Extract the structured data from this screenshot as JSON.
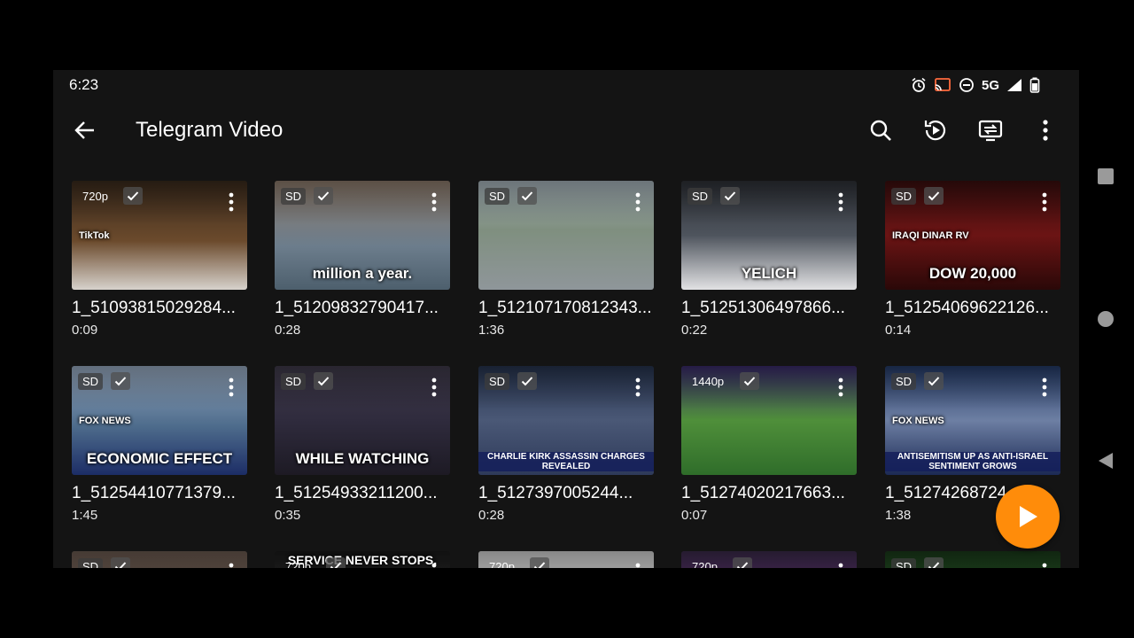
{
  "status": {
    "time": "6:23",
    "network": "5G"
  },
  "header": {
    "title": "Telegram Video"
  },
  "colors": {
    "accent": "#ff8c0a",
    "background": "#141414"
  },
  "videos": [
    {
      "quality": "720p",
      "name": "1_51093815029284...",
      "duration": "0:09",
      "caption": "",
      "overlay": "TikTok"
    },
    {
      "quality": "SD",
      "name": "1_51209832790417...",
      "duration": "0:28",
      "caption": "million a year.",
      "overlay": ""
    },
    {
      "quality": "SD",
      "name": "1_512107170812343...",
      "duration": "1:36",
      "caption": "",
      "overlay": ""
    },
    {
      "quality": "SD",
      "name": "1_51251306497866...",
      "duration": "0:22",
      "caption": "YELICH",
      "overlay": ""
    },
    {
      "quality": "SD",
      "name": "1_51254069622126...",
      "duration": "0:14",
      "caption": "DOW 20,000",
      "overlay": "IRAQI DINAR RV"
    },
    {
      "quality": "SD",
      "name": "1_51254410771379...",
      "duration": "1:45",
      "caption": "ECONOMIC EFFECT",
      "overlay": "FOX NEWS"
    },
    {
      "quality": "SD",
      "name": "1_51254933211200...",
      "duration": "0:35",
      "caption": "WHILE WATCHING",
      "overlay": ""
    },
    {
      "quality": "SD",
      "name": "1_5127397005244...",
      "duration": "0:28",
      "caption": "CHARLIE KIRK ASSASSIN CHARGES REVEALED",
      "overlay": ""
    },
    {
      "quality": "1440p",
      "name": "1_51274020217663...",
      "duration": "0:07",
      "caption": "",
      "overlay": ""
    },
    {
      "quality": "SD",
      "name": "1_51274268724...",
      "duration": "1:38",
      "caption": "ANTISEMITISM UP AS ANTI-ISRAEL SENTIMENT GROWS",
      "overlay": "FOX NEWS"
    },
    {
      "quality": "SD",
      "name": "",
      "duration": "",
      "caption": "",
      "overlay": ""
    },
    {
      "quality": "720p",
      "name": "",
      "duration": "",
      "caption": "SERVICE NEVER STOPS.",
      "overlay": ""
    },
    {
      "quality": "720p",
      "name": "",
      "duration": "",
      "caption": "",
      "overlay": ""
    },
    {
      "quality": "720p",
      "name": "",
      "duration": "",
      "caption": "",
      "overlay": ""
    },
    {
      "quality": "SD",
      "name": "",
      "duration": "",
      "caption": "",
      "overlay": ""
    }
  ]
}
